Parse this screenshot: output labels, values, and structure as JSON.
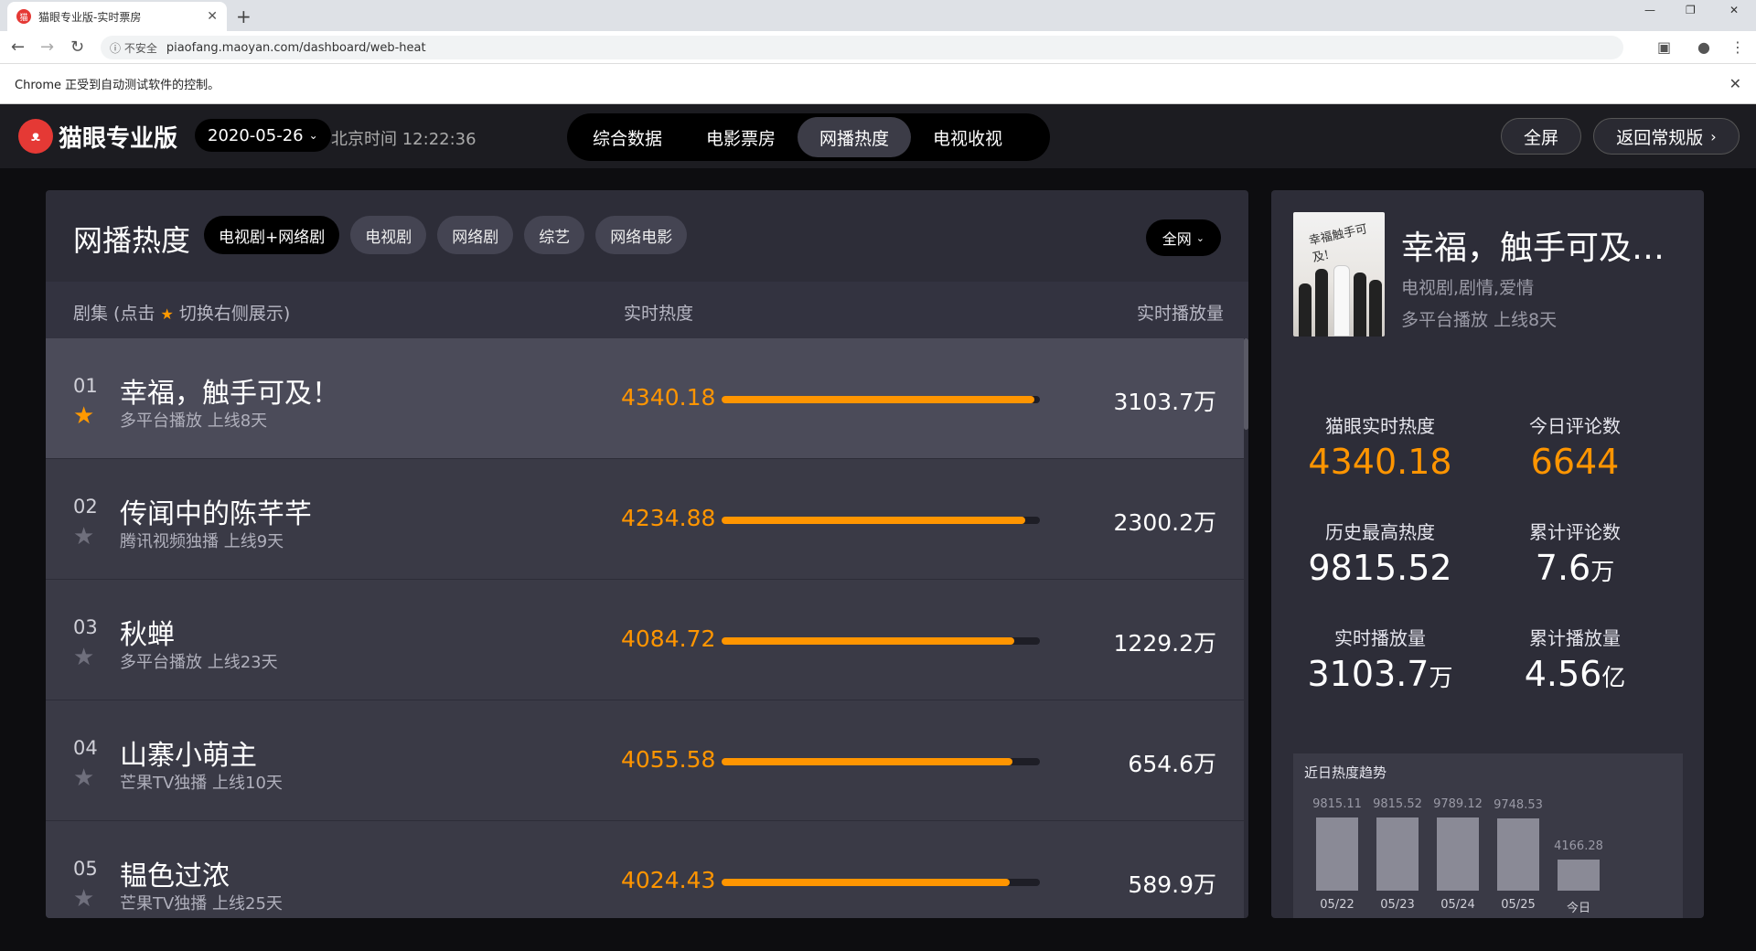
{
  "browser": {
    "tab_title": "猫眼专业版-实时票房",
    "insecure_label": "不安全",
    "url": "piaofang.maoyan.com/dashboard/web-heat",
    "automation_notice": "Chrome 正受到自动测试软件的控制。"
  },
  "header": {
    "logo_text": "猫眼专业版",
    "date": "2020-05-26",
    "clock": "北京时间 12:22:36",
    "tabs": [
      "综合数据",
      "电影票房",
      "网播热度",
      "电视收视"
    ],
    "active_tab": "网播热度",
    "fullscreen_label": "全屏",
    "back_label": "返回常规版"
  },
  "panel": {
    "title": "网播热度",
    "filters": [
      "电视剧+网络剧",
      "电视剧",
      "网络剧",
      "综艺",
      "网络电影"
    ],
    "active_filter": "电视剧+网络剧",
    "scope": "全网",
    "columns": {
      "series_prefix": "剧集 (点击",
      "series_suffix": "切换右侧展示)",
      "heat": "实时热度",
      "plays": "实时播放量"
    },
    "rows": [
      {
        "rank": "01",
        "name": "幸福，触手可及！",
        "sub": "多平台播放  上线8天",
        "heat": "4340.18",
        "heat_pct": 0.9815,
        "plays": "3103.7万",
        "starred": true
      },
      {
        "rank": "02",
        "name": "传闻中的陈芊芊",
        "sub": "腾讯视频独播  上线9天",
        "heat": "4234.88",
        "heat_pct": 0.954,
        "plays": "2300.2万",
        "starred": false
      },
      {
        "rank": "03",
        "name": "秋蝉",
        "sub": "多平台播放  上线23天",
        "heat": "4084.72",
        "heat_pct": 0.92,
        "plays": "1229.2万",
        "starred": false
      },
      {
        "rank": "04",
        "name": "山寨小萌主",
        "sub": "芒果TV独播  上线10天",
        "heat": "4055.58",
        "heat_pct": 0.913,
        "plays": "654.6万",
        "starred": false
      },
      {
        "rank": "05",
        "name": "韫色过浓",
        "sub": "芒果TV独播  上线25天",
        "heat": "4024.43",
        "heat_pct": 0.906,
        "plays": "589.9万",
        "starred": false
      }
    ]
  },
  "detail": {
    "title": "幸福，触手可及…",
    "genre": "电视剧,剧情,爱情",
    "meta": "多平台播放  上线8天",
    "poster_text": "幸福触手可及!",
    "stats": [
      {
        "label": "猫眼实时热度",
        "value": "4340.18",
        "unit": "",
        "highlight": true
      },
      {
        "label": "今日评论数",
        "value": "6644",
        "unit": "",
        "highlight": true
      },
      {
        "label": "历史最高热度",
        "value": "9815.52",
        "unit": "",
        "highlight": false
      },
      {
        "label": "累计评论数",
        "value": "7.6",
        "unit": "万",
        "highlight": false
      },
      {
        "label": "实时播放量",
        "value": "3103.7",
        "unit": "万",
        "highlight": false
      },
      {
        "label": "累计播放量",
        "value": "4.56",
        "unit": "亿",
        "highlight": false
      }
    ],
    "trend": {
      "title": "近日热度趋势",
      "points": [
        {
          "date": "05/22",
          "value": 9815.11,
          "label": "9815.11"
        },
        {
          "date": "05/23",
          "value": 9815.52,
          "label": "9815.52"
        },
        {
          "date": "05/24",
          "value": 9789.12,
          "label": "9789.12"
        },
        {
          "date": "05/25",
          "value": 9748.53,
          "label": "9748.53"
        },
        {
          "date": "今日",
          "value": 4166.28,
          "label": "4166.28"
        }
      ]
    }
  },
  "colors": {
    "accent": "#ff9500",
    "panel_bg": "#2d2d38",
    "row_bg": "#3a3a46",
    "selected_row_bg": "#4b4b59"
  }
}
